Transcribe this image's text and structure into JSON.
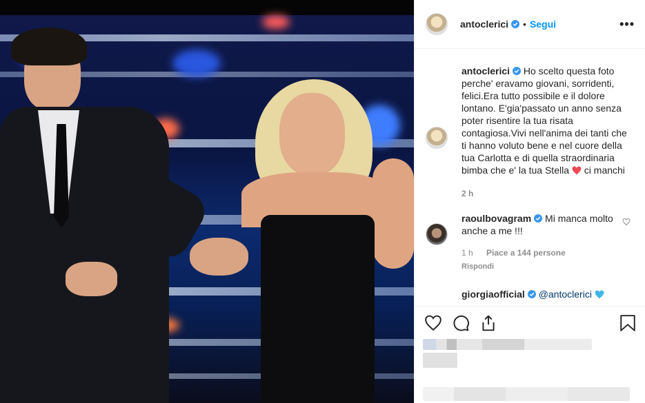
{
  "post": {
    "author": "antoclerici",
    "follow_label": "Segui",
    "dot": "•",
    "more": "•••"
  },
  "caption": {
    "author": "antoclerici",
    "text": "Ho scelto questa foto perche' eravamo giovani, sorridenti, felici.Era tutto possibile e il dolore lontano. E'gia'passato un anno senza poter risentire la tua risata contagiosa.Vivi nell'anima dei tanti che ti hanno voluto bene e nel cuore della tua Carlotta e di quella straordinaria bimba che e' la tua Stella",
    "tail": "ci manchi",
    "time": "2 h",
    "heart_color": "#ed4956"
  },
  "comments": [
    {
      "author": "raoulbovagram",
      "text": "Mi manca molto anche a me !!!",
      "time": "1 h",
      "likes": "Piace a 144 persone",
      "reply": "Rispondi"
    },
    {
      "author": "giorgiaofficial",
      "mention": "@antoclerici"
    }
  ],
  "icons": {
    "like": "heart-outline-icon",
    "comment": "comment-icon",
    "share": "share-icon",
    "save": "bookmark-icon",
    "verified": "verified-badge-icon"
  },
  "colors": {
    "accent": "#0095f6",
    "verified": "#3897f0",
    "secondary_text": "#8e8e8e"
  }
}
